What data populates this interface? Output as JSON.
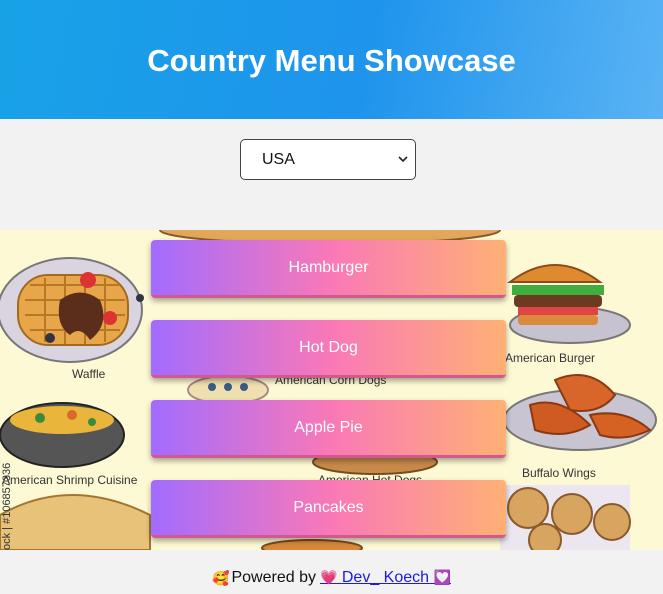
{
  "header": {
    "title": "Country Menu Showcase"
  },
  "country_select": {
    "selected": "USA"
  },
  "background_image": {
    "labels": [
      "Waffle",
      "American Burger",
      "American Corn Dogs",
      "American Shrimp Cuisine",
      "Buffalo Wings",
      "American Hot Dogs"
    ],
    "watermark_text": "ock | #106857336"
  },
  "menu": {
    "items": [
      {
        "label": "Hamburger"
      },
      {
        "label": "Hot Dog"
      },
      {
        "label": "Apple Pie"
      },
      {
        "label": "Pancakes"
      }
    ]
  },
  "footer": {
    "prefix_emoji": "🥰",
    "text": "Powered by",
    "link_prefix_emoji": "💗",
    "link_text": "Dev_ Koech",
    "link_suffix_emoji": "💟"
  },
  "colors": {
    "header_gradient_start": "#18a2e6",
    "header_gradient_end": "#5ab3f4",
    "button_gradient_start": "#a26cff",
    "button_gradient_mid": "#f978b8",
    "button_gradient_end": "#ffb075",
    "page_background": "#f2f2f2",
    "link": "#1a1aee"
  }
}
